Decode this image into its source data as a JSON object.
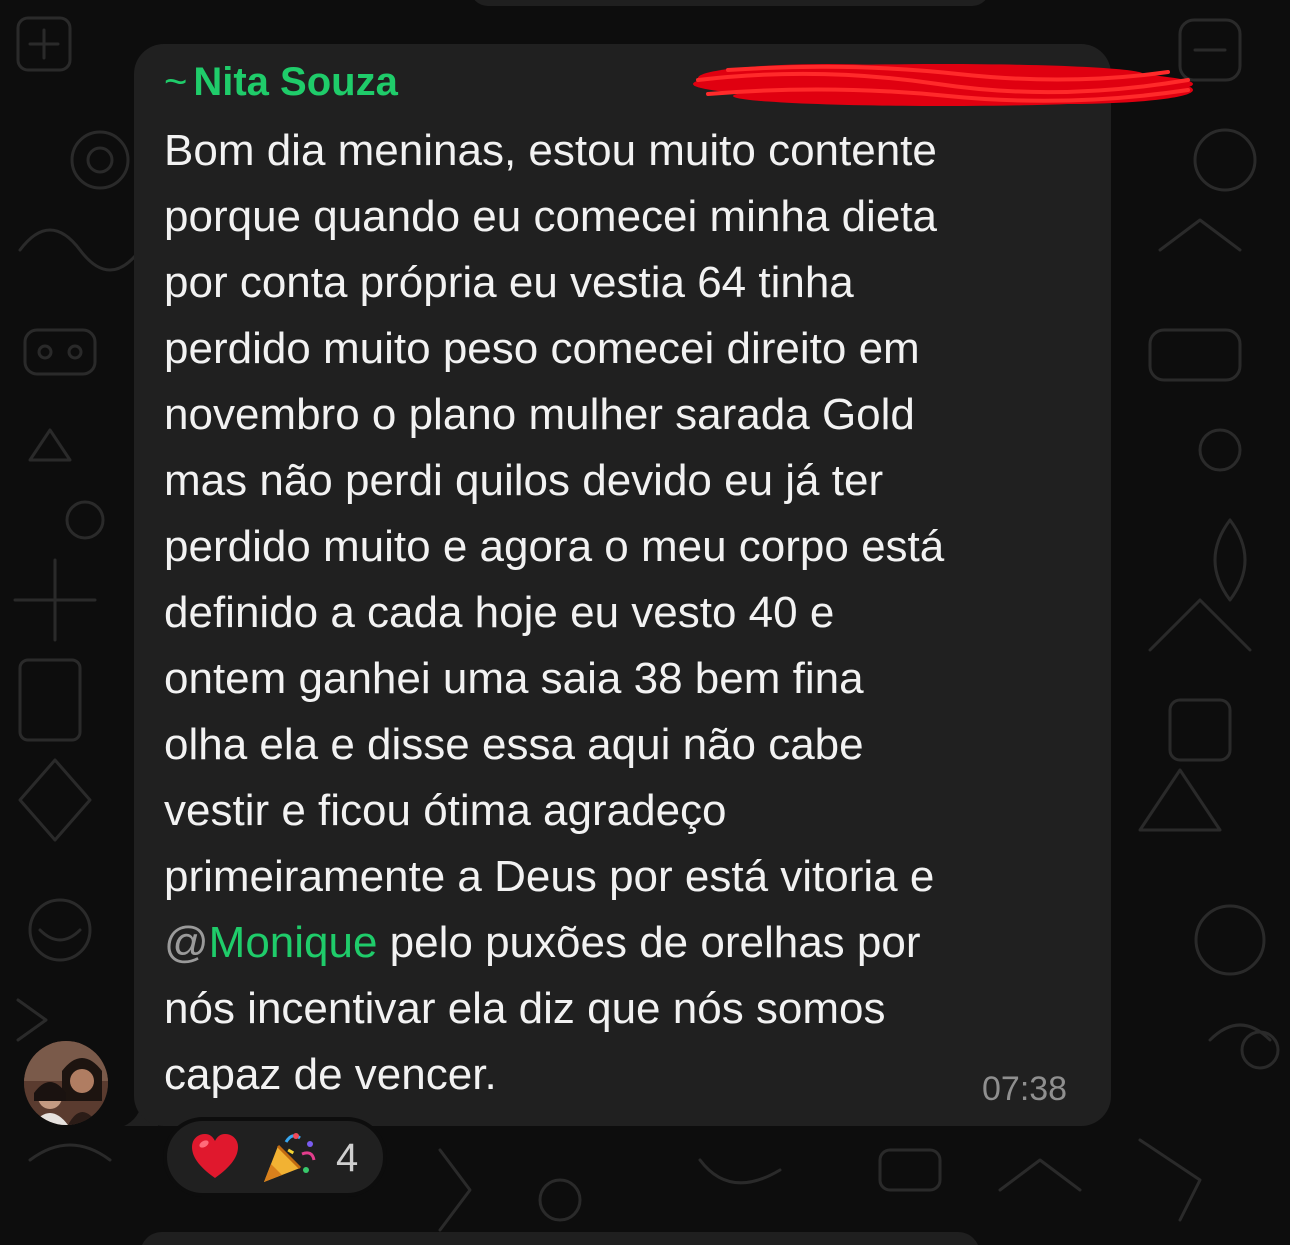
{
  "message": {
    "sender_prefix": "~",
    "sender_name": "Nita Souza",
    "text_before_mention": "Bom dia meninas, estou muito contente\nporque quando eu comecei minha dieta\npor conta própria eu vestia 64  tinha\nperdido muito peso comecei direito em\nnovembro o plano mulher sarada Gold\nmas não perdi quilos devido eu já ter\nperdido muito e agora o meu corpo está\ndefinido a cada  hoje eu vesto 40 e\nontem ganhei uma saia 38  bem fina\nolha ela e disse essa aqui não cabe\nvestir e ficou ótima agradeço\nprimeiramente a Deus por está vitoria e\n",
    "mention_at": "@",
    "mention_name": "Monique",
    "text_after_mention": " pelo puxões de orelhas por\nnós incentivar ela diz que nós somos\ncapaz de vencer.",
    "time": "07:38",
    "sender_info_redacted": true
  },
  "reactions": {
    "emojis": [
      "❤️",
      "🎉"
    ],
    "count": "4"
  },
  "colors": {
    "background": "#0d0d0d",
    "bubble": "#202020",
    "sender_name": "#1fcc6a",
    "mention": "#1fcc6a",
    "message_text": "#f2f2f2",
    "timestamp": "#8f8f8f",
    "redaction": "#e00010"
  },
  "icons": {
    "avatar": "profile-photo",
    "wallpaper": "whatsapp-doodle-pattern"
  }
}
